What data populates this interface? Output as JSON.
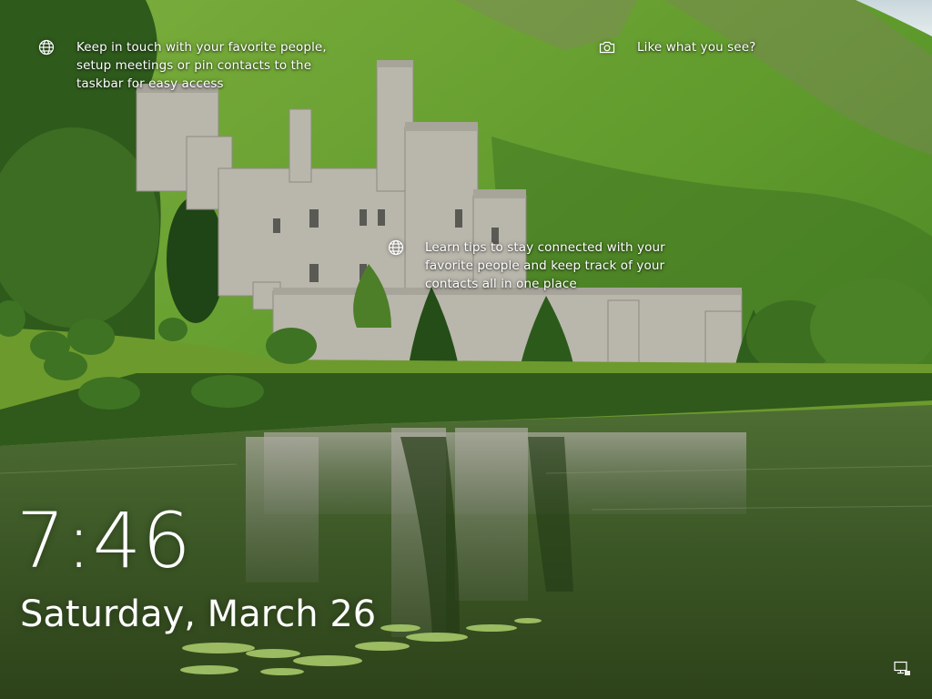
{
  "lockscreen": {
    "hotspots": [
      {
        "id": "contacts",
        "icon": "globe-icon",
        "text": "Keep in touch with your favorite people, setup meetings or pin contacts to the taskbar for easy access"
      },
      {
        "id": "like",
        "icon": "camera-icon",
        "text": "Like what you see?"
      },
      {
        "id": "tips",
        "icon": "globe-icon",
        "text": "Learn tips to stay connected with your favorite people and keep track of your contacts all in one place"
      }
    ],
    "clock": {
      "time": "7:46",
      "date": "Saturday, March 26"
    },
    "tray": {
      "network_icon": "network-icon"
    }
  },
  "colors": {
    "text": "#ffffff",
    "hill": "#5f9a2c",
    "water": "#3d5a26",
    "castle": "#b9b6ac"
  }
}
